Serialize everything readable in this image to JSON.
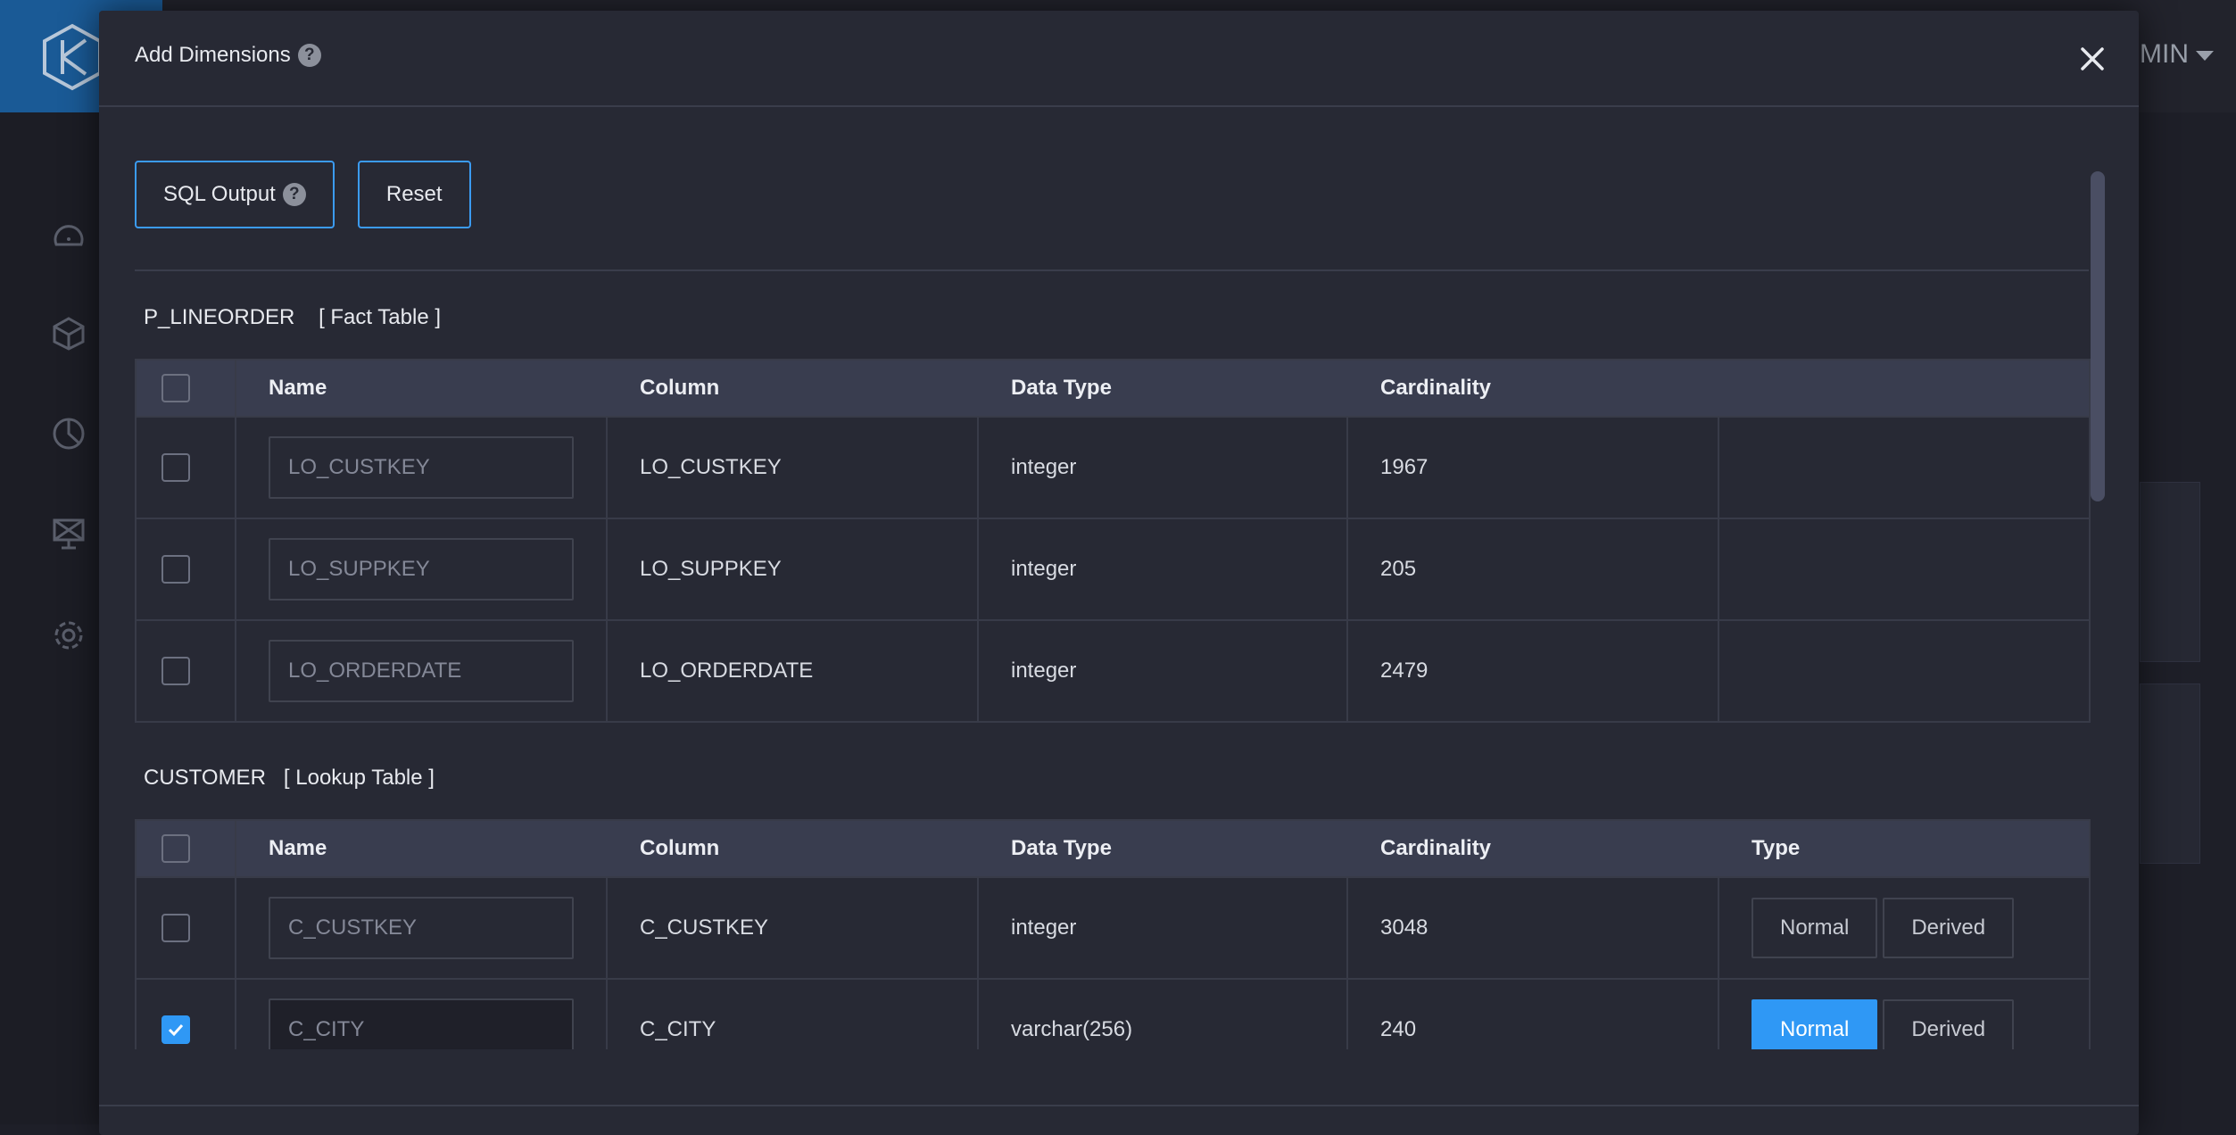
{
  "app": {
    "user_label": "MIN"
  },
  "modal": {
    "title": "Add Dimensions",
    "toolbar": {
      "sql_output_label": "SQL Output",
      "reset_label": "Reset"
    }
  },
  "fact_table": {
    "name": "P_LINEORDER",
    "tag": "[ Fact Table ]",
    "headers": {
      "name": "Name",
      "column": "Column",
      "data_type": "Data Type",
      "cardinality": "Cardinality"
    },
    "rows": [
      {
        "checked": false,
        "name_placeholder": "LO_CUSTKEY",
        "column": "LO_CUSTKEY",
        "data_type": "integer",
        "cardinality": "1967"
      },
      {
        "checked": false,
        "name_placeholder": "LO_SUPPKEY",
        "column": "LO_SUPPKEY",
        "data_type": "integer",
        "cardinality": "205"
      },
      {
        "checked": false,
        "name_placeholder": "LO_ORDERDATE",
        "column": "LO_ORDERDATE",
        "data_type": "integer",
        "cardinality": "2479"
      }
    ]
  },
  "lookup_table": {
    "name": "CUSTOMER",
    "tag": "[ Lookup Table ]",
    "headers": {
      "name": "Name",
      "column": "Column",
      "data_type": "Data Type",
      "cardinality": "Cardinality",
      "type": "Type"
    },
    "type_options": {
      "normal": "Normal",
      "derived": "Derived"
    },
    "rows": [
      {
        "checked": false,
        "name_placeholder": "C_CUSTKEY",
        "column": "C_CUSTKEY",
        "data_type": "integer",
        "cardinality": "3048",
        "selected_type": "none"
      },
      {
        "checked": true,
        "name_placeholder": "C_CITY",
        "column": "C_CITY",
        "data_type": "varchar(256)",
        "cardinality": "240",
        "selected_type": "Normal"
      }
    ]
  },
  "colors": {
    "accent": "#2f98f5",
    "modal_bg": "#272934",
    "header_bg": "#393d4f"
  }
}
